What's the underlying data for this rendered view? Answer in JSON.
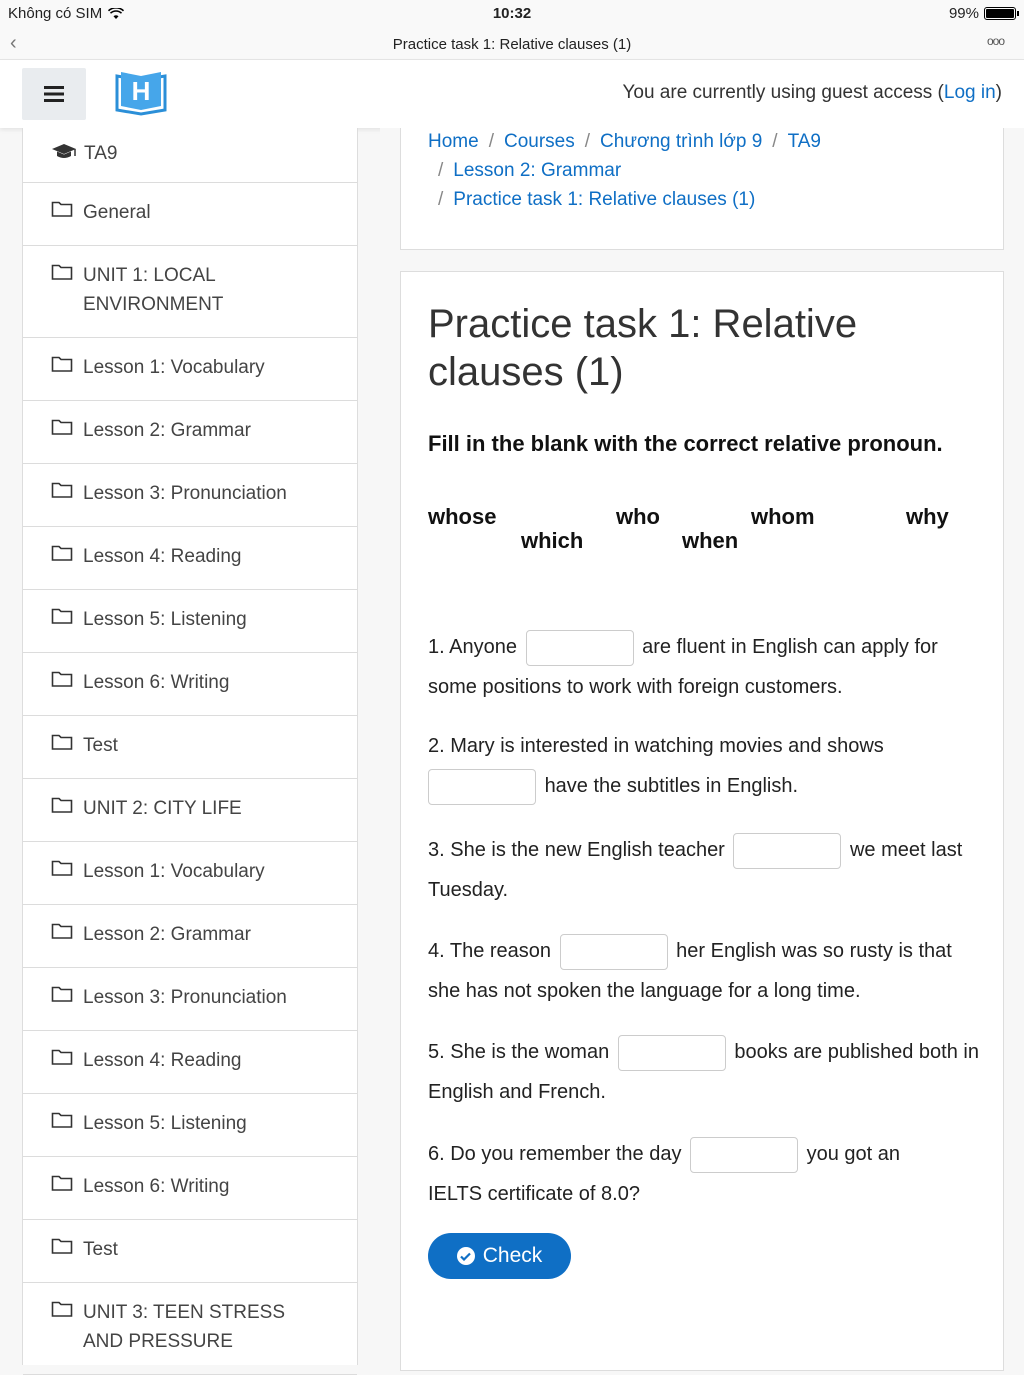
{
  "status_bar": {
    "carrier": "Không có SIM",
    "time": "10:32",
    "battery": "99%"
  },
  "nav": {
    "title": "Practice task 1: Relative clauses (1)",
    "more": "ooo"
  },
  "header": {
    "guest_text": "You are currently using guest access (",
    "login": "Log in",
    "guest_end": ")"
  },
  "sidebar": {
    "course": "TA9",
    "items": [
      {
        "label": "General"
      },
      {
        "label": "UNIT 1: LOCAL ENVIRONMENT"
      },
      {
        "label": "Lesson 1: Vocabulary"
      },
      {
        "label": "Lesson 2: Grammar"
      },
      {
        "label": "Lesson 3: Pronunciation"
      },
      {
        "label": "Lesson 4: Reading"
      },
      {
        "label": "Lesson 5: Listening"
      },
      {
        "label": "Lesson 6: Writing"
      },
      {
        "label": "Test"
      },
      {
        "label": "UNIT 2: CITY LIFE"
      },
      {
        "label": "Lesson 1: Vocabulary"
      },
      {
        "label": "Lesson 2: Grammar"
      },
      {
        "label": "Lesson 3: Pronunciation"
      },
      {
        "label": "Lesson 4: Reading"
      },
      {
        "label": "Lesson 5: Listening"
      },
      {
        "label": "Lesson 6: Writing"
      },
      {
        "label": "Test"
      },
      {
        "label": "UNIT 3: TEEN STRESS AND PRESSURE"
      }
    ]
  },
  "breadcrumb": {
    "home": "Home",
    "courses": "Courses",
    "program": "Chương trình lớp 9",
    "course": "TA9",
    "lesson": "Lesson 2: Grammar",
    "task": "Practice task 1: Relative clauses (1)",
    "sep": "/"
  },
  "main": {
    "title": "Practice task 1: Relative clauses (1)",
    "instruction": "Fill in the blank with the correct relative pronoun.",
    "words": [
      "whose",
      "which",
      "who",
      "when",
      "whom",
      "why"
    ],
    "questions": [
      {
        "before": "1. Anyone",
        "after": "are fluent in English can apply for some positions to work with foreign customers."
      },
      {
        "before": "2. Mary is interested in watching movies and shows",
        "after": "have the subtitles in English."
      },
      {
        "before": "3. She is the new English teacher",
        "after": "we meet last Tuesday."
      },
      {
        "before": "4. The reason",
        "after": "her English was so rusty is that she has not spoken the language for a long time."
      },
      {
        "before": "5. She is the woman",
        "after": "books are published both in English and French."
      },
      {
        "before": "6. Do you remember the day",
        "after": "you got an IELTS certificate of 8.0?"
      }
    ],
    "check_label": "Check"
  },
  "colors": {
    "link": "#0f6fc5",
    "button": "#0f6fc5"
  }
}
